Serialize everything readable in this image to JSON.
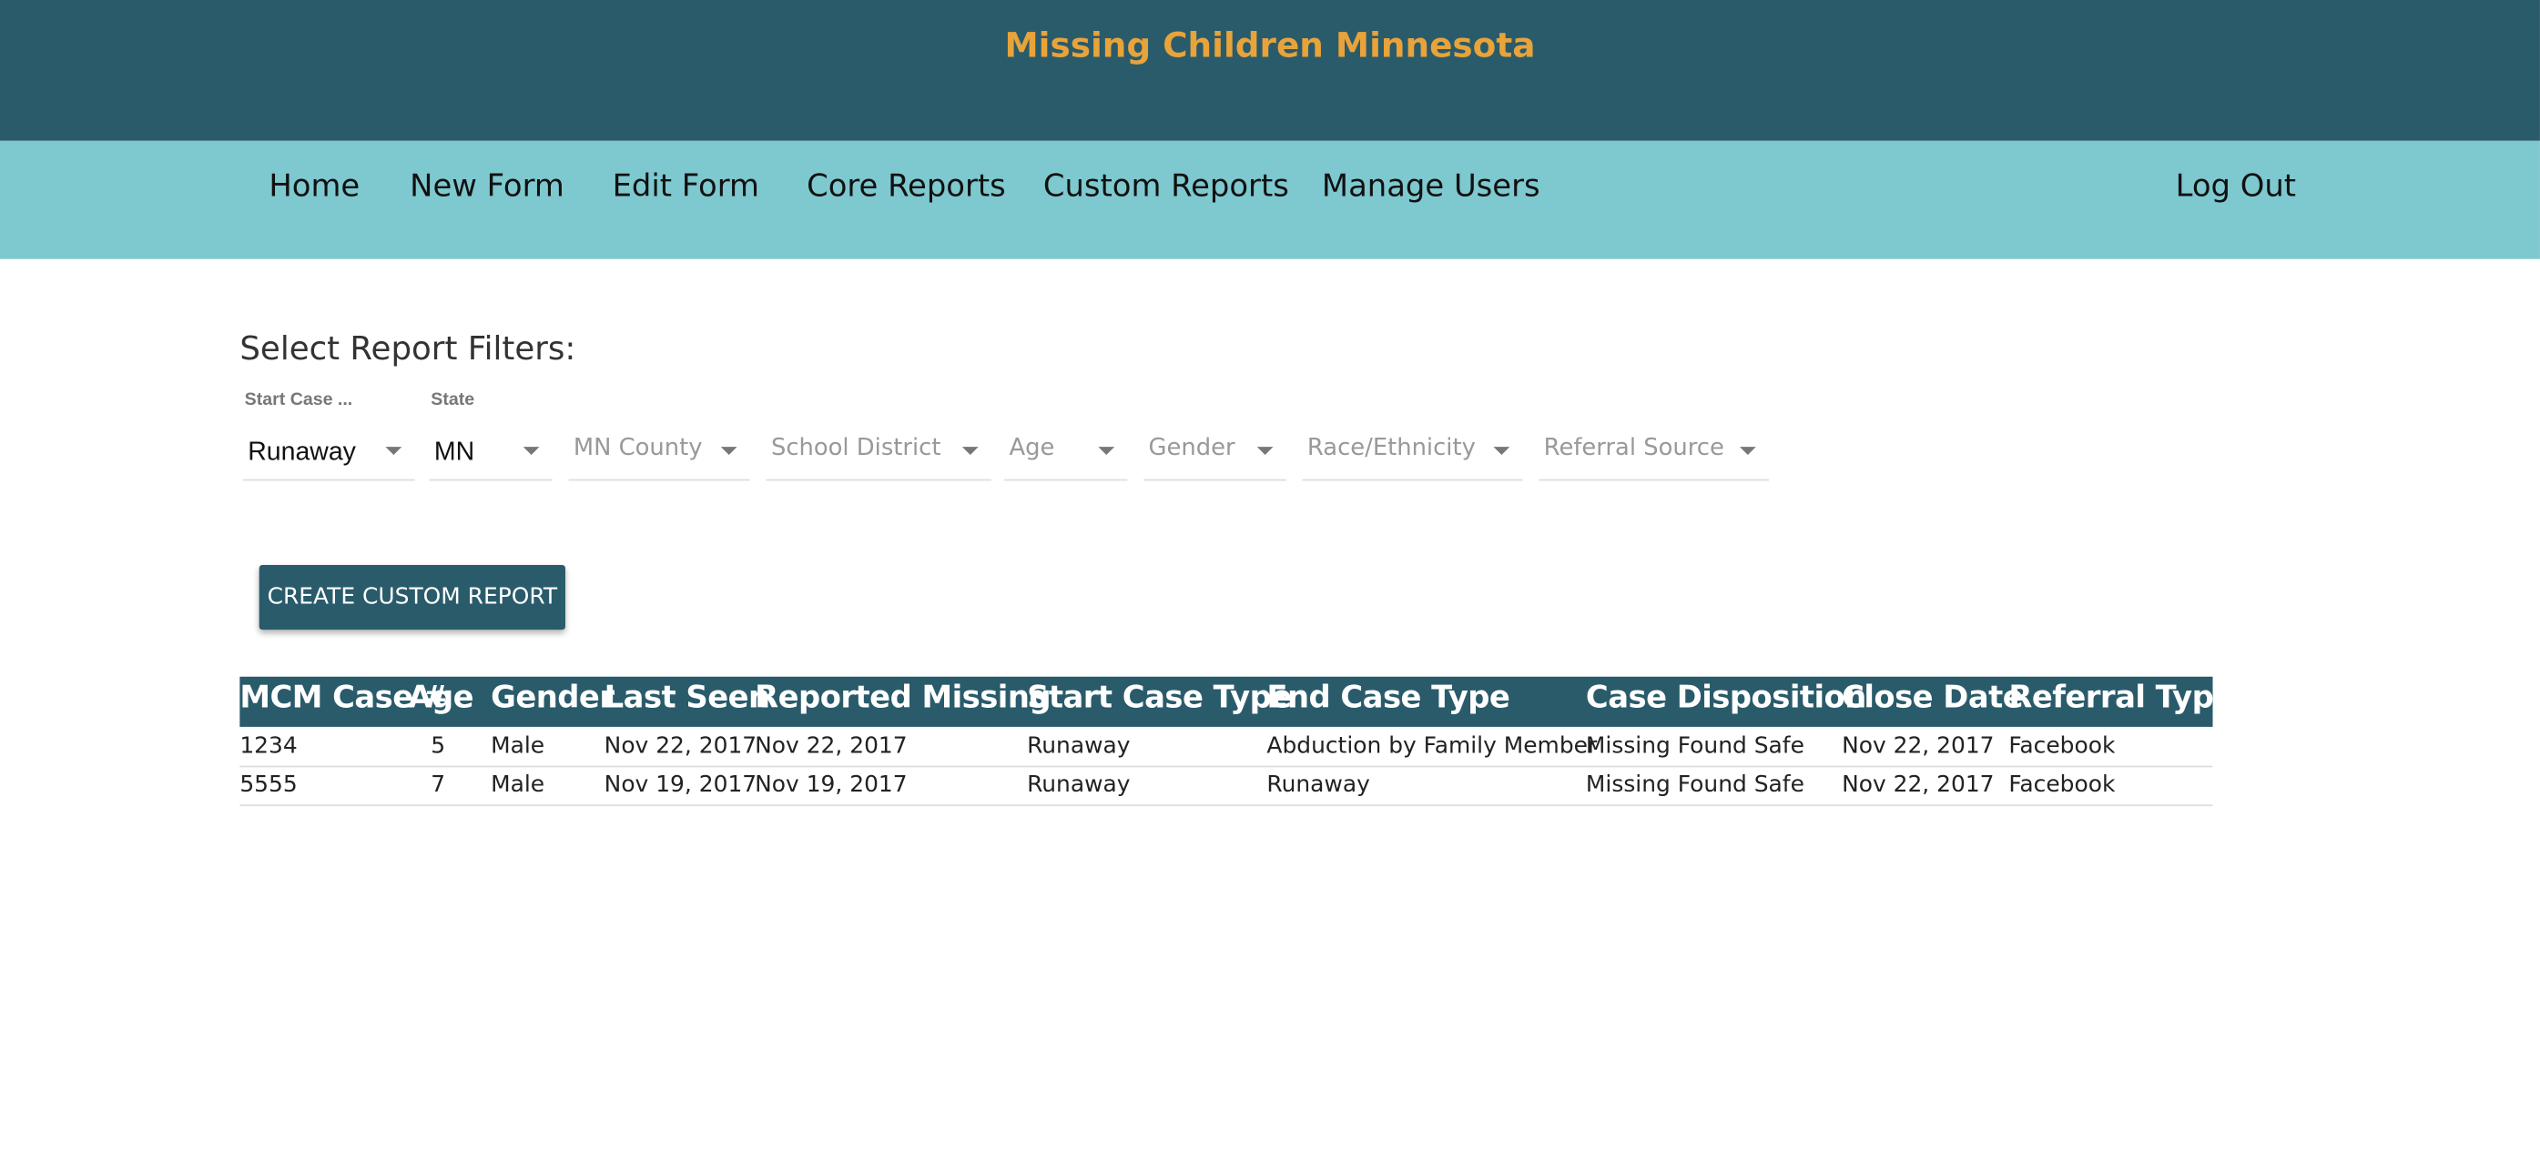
{
  "app": {
    "title": "Missing Children Minnesota",
    "colors": {
      "header": "#2a5b6b",
      "nav": "#7ec8cf",
      "title": "#e8a33a"
    }
  },
  "nav": {
    "items": [
      "Home",
      "New Form",
      "Edit Form",
      "Core Reports",
      "Custom Reports",
      "Manage Users"
    ],
    "logout": "Log Out"
  },
  "filters": {
    "title": "Select Report Filters:",
    "selects": [
      {
        "label": "Start Case ...",
        "value": "Runaway",
        "placeholder": ""
      },
      {
        "label": "State",
        "value": "MN",
        "placeholder": ""
      },
      {
        "label": "",
        "value": "",
        "placeholder": "MN County"
      },
      {
        "label": "",
        "value": "",
        "placeholder": "School District"
      },
      {
        "label": "",
        "value": "",
        "placeholder": "Age"
      },
      {
        "label": "",
        "value": "",
        "placeholder": "Gender"
      },
      {
        "label": "",
        "value": "",
        "placeholder": "Race/Ethnicity"
      },
      {
        "label": "",
        "value": "",
        "placeholder": "Referral Source"
      }
    ],
    "button": "CREATE CUSTOM REPORT"
  },
  "table": {
    "headers": [
      "MCM Case #",
      "Age",
      "Gender",
      "Last Seen",
      "Reported Missing",
      "Start Case Type",
      "End Case Type",
      "Case Disposition",
      "Close Date",
      "Referral Type"
    ],
    "rows": [
      [
        "1234",
        "5",
        "Male",
        "Nov 22, 2017",
        "Nov 22, 2017",
        "Runaway",
        "Abduction by Family Member",
        "Missing Found Safe",
        "Nov 22, 2017",
        "Facebook"
      ],
      [
        "5555",
        "7",
        "Male",
        "Nov 19, 2017",
        "Nov 19, 2017",
        "Runaway",
        "Runaway",
        "Missing Found Safe",
        "Nov 22, 2017",
        "Facebook"
      ]
    ]
  }
}
